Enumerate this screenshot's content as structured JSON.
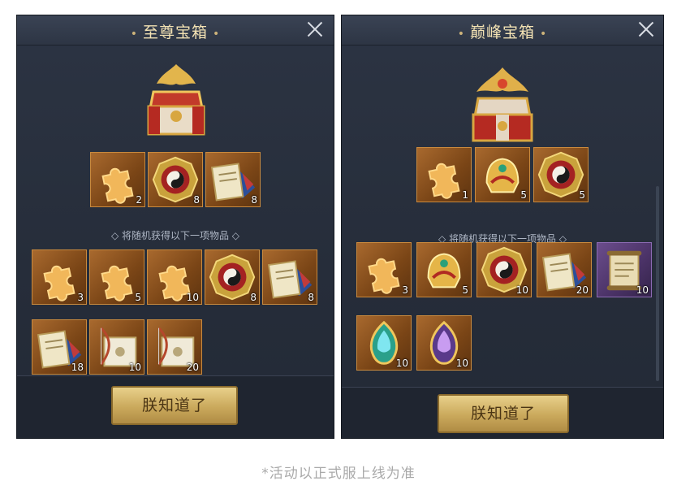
{
  "left_panel": {
    "title": "至尊宝箱",
    "title_dots": "•",
    "guaranteed_items": [
      {
        "icon": "puzzle-fragment-icon",
        "qty": "2"
      },
      {
        "icon": "yin-yang-token-icon",
        "qty": "8"
      },
      {
        "icon": "scroll-book-icon",
        "qty": "8"
      }
    ],
    "random_hint": "◇ 将随机获得以下一项物品 ◇",
    "random_items": [
      {
        "icon": "puzzle-fragment-icon",
        "qty": "3"
      },
      {
        "icon": "puzzle-fragment-icon",
        "qty": "5"
      },
      {
        "icon": "puzzle-fragment-icon",
        "qty": "10"
      },
      {
        "icon": "yin-yang-token-icon",
        "qty": "8"
      },
      {
        "icon": "scroll-book-icon",
        "qty": "8"
      },
      {
        "icon": "scroll-book-icon",
        "qty": "18"
      },
      {
        "icon": "bow-scroll-icon",
        "qty": "10"
      },
      {
        "icon": "bow-scroll-icon",
        "qty": "20"
      }
    ],
    "confirm_label": "朕知道了"
  },
  "right_panel": {
    "title": "巅峰宝箱",
    "title_dots": "•",
    "guaranteed_items": [
      {
        "icon": "puzzle-fragment-icon",
        "qty": "1"
      },
      {
        "icon": "golden-helmet-icon",
        "qty": "5"
      },
      {
        "icon": "yin-yang-token-icon",
        "qty": "5"
      }
    ],
    "random_hint": "◇ 将随机获得以下一项物品 ◇",
    "random_items": [
      {
        "icon": "puzzle-fragment-icon",
        "qty": "3"
      },
      {
        "icon": "golden-helmet-icon",
        "qty": "5"
      },
      {
        "icon": "yin-yang-token-icon",
        "qty": "10"
      },
      {
        "icon": "scroll-book-icon",
        "qty": "20"
      },
      {
        "icon": "ancient-scroll-icon",
        "qty": "10",
        "rarity": "purple"
      },
      {
        "icon": "blue-gem-icon",
        "qty": "10"
      },
      {
        "icon": "purple-gem-icon",
        "qty": "10"
      }
    ],
    "confirm_label": "朕知道了"
  },
  "caption": "*活动以正式服上线为准",
  "colors": {
    "panel_bg": "#262d3a",
    "title_text": "#f3e2b3",
    "item_frame": "#c98a3e",
    "button_gold": "#caa95c"
  }
}
